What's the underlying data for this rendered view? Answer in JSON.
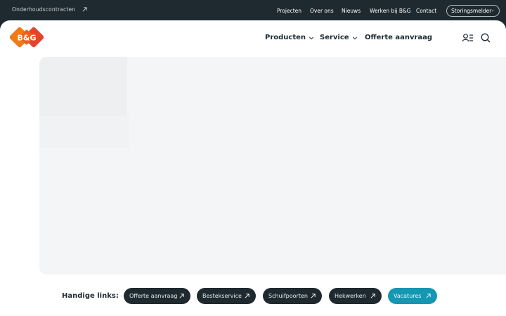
{
  "topbar": {
    "contracts_link": "Onderhoudscontracten",
    "nav": [
      "Projecten",
      "Over ons",
      "Nieuws",
      "Werken bij B&G",
      "Contact"
    ],
    "storing_button": "Storingsmelder"
  },
  "header": {
    "logo_text": "B&G",
    "nav": [
      {
        "label": "Producten",
        "dropdown": true
      },
      {
        "label": "Service",
        "dropdown": true
      },
      {
        "label": "Offerte aanvraag",
        "dropdown": false
      }
    ],
    "icons": [
      "account-menu-icon",
      "search-icon"
    ]
  },
  "handy_links": {
    "label": "Handige links:",
    "links": [
      "Offerte aanvraag",
      "Bestekservice",
      "Schuifpoorten",
      "Hekwerken",
      "Vacatures"
    ]
  },
  "colors": {
    "dark": "#1f2a30",
    "accent": "#1597b2",
    "logo_orange": "#f07a1a",
    "logo_red": "#e2452b"
  }
}
